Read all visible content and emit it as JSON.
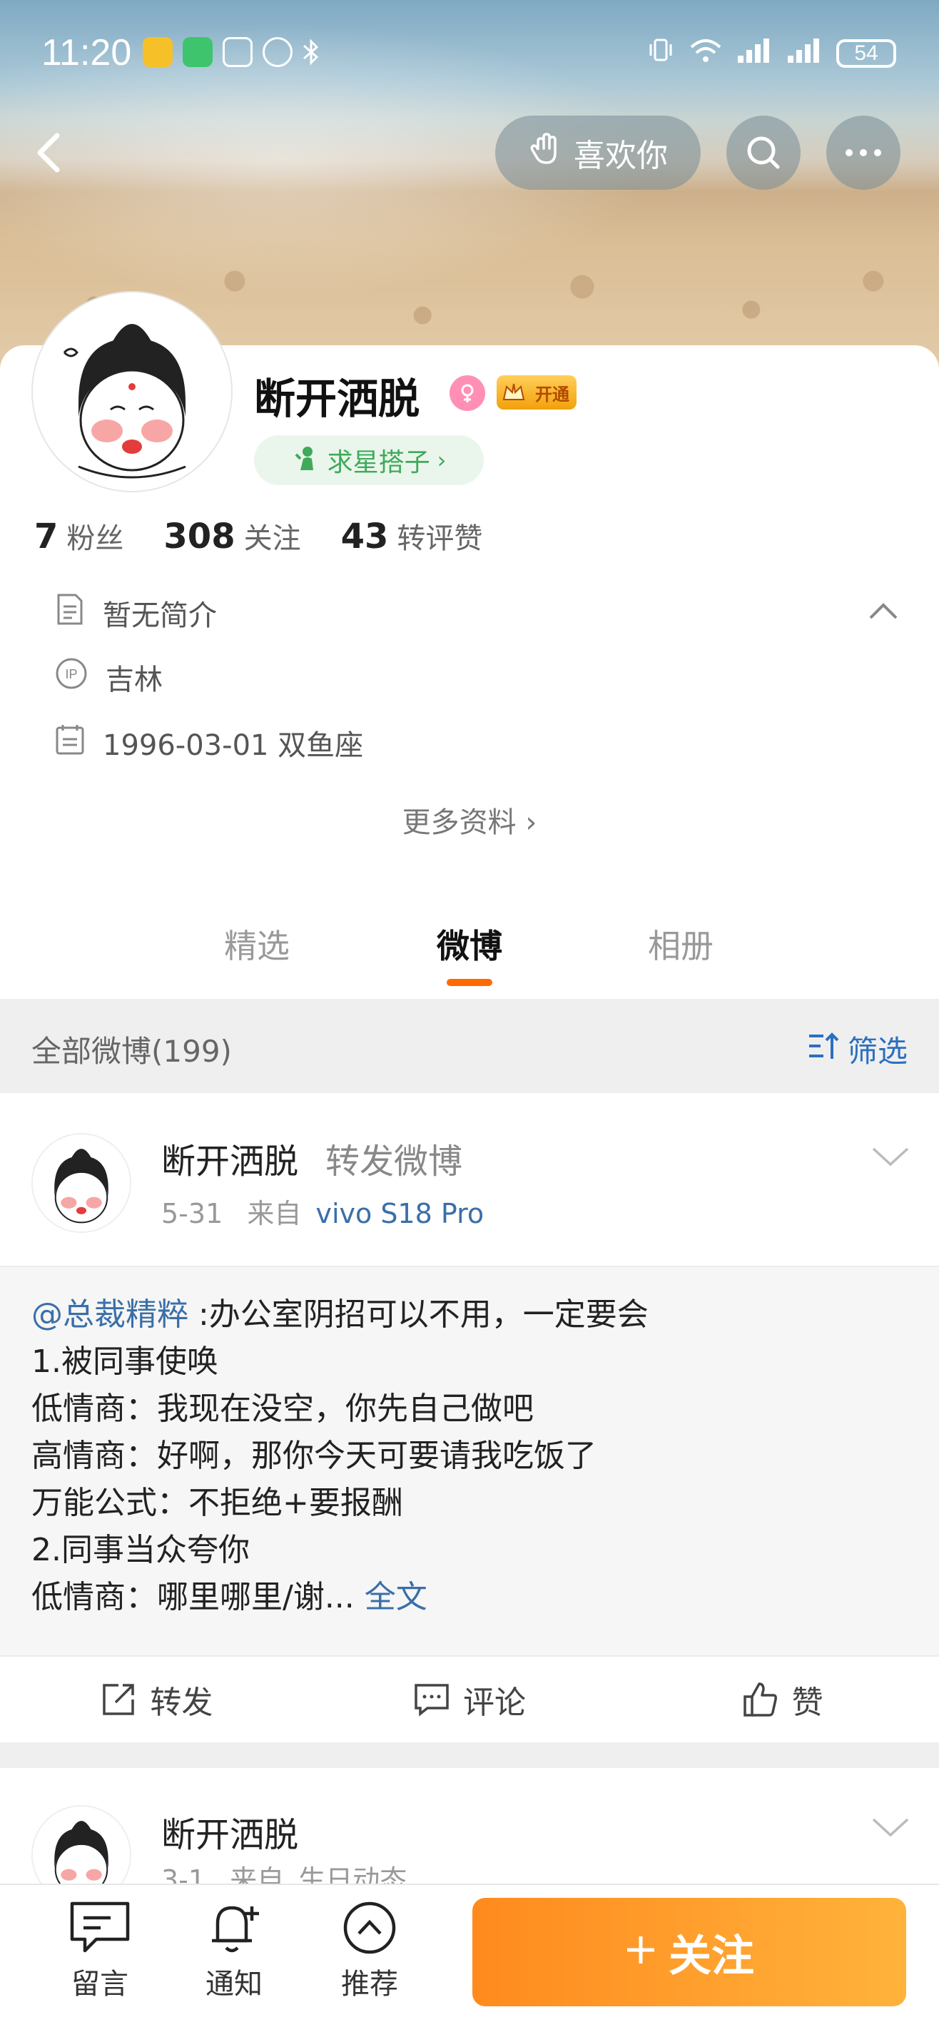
{
  "status_bar": {
    "time": "11:20",
    "battery": "54"
  },
  "top_nav": {
    "like_label": "喜欢你"
  },
  "profile": {
    "name": "断开洒脱",
    "vip_label": "开通",
    "star_label": "求星搭子",
    "stats": [
      {
        "num": "7",
        "label": "粉丝"
      },
      {
        "num": "308",
        "label": "关注"
      },
      {
        "num": "43",
        "label": "转评赞"
      }
    ],
    "bio": "暂无简介",
    "location": "吉林",
    "birthday": "1996-03-01 双鱼座",
    "more_info": "更多资料"
  },
  "tabs": [
    {
      "label": "精选"
    },
    {
      "label": "微博"
    },
    {
      "label": "相册"
    }
  ],
  "filter": {
    "count_label": "全部微博(199)",
    "filter_label": "筛选"
  },
  "post1": {
    "author": "断开洒脱",
    "action": "转发微博",
    "date": "5-31",
    "from": "来自",
    "source": "vivo S18 Pro",
    "mention": "@总裁精粹",
    "line1_rest": " :办公室阴招可以不用，一定要会",
    "line2": "1.被同事使唤",
    "line3": "低情商：我现在没空，你先自己做吧",
    "line4": "高情商：好啊，那你今天可要请我吃饭了",
    "line5": "万能公式：不拒绝+要报酬",
    "line6": "2.同事当众夸你",
    "line7": "低情商：哪里哪里/谢...",
    "fulltext": "全文",
    "actions": {
      "repost": "转发",
      "comment": "评论",
      "like": "赞"
    }
  },
  "post2": {
    "author": "断开洒脱",
    "date": "3-1",
    "from": "来自",
    "source": "生日动态"
  },
  "bottom_bar": {
    "message": "留言",
    "notify": "通知",
    "recommend": "推荐",
    "follow": "关注"
  }
}
